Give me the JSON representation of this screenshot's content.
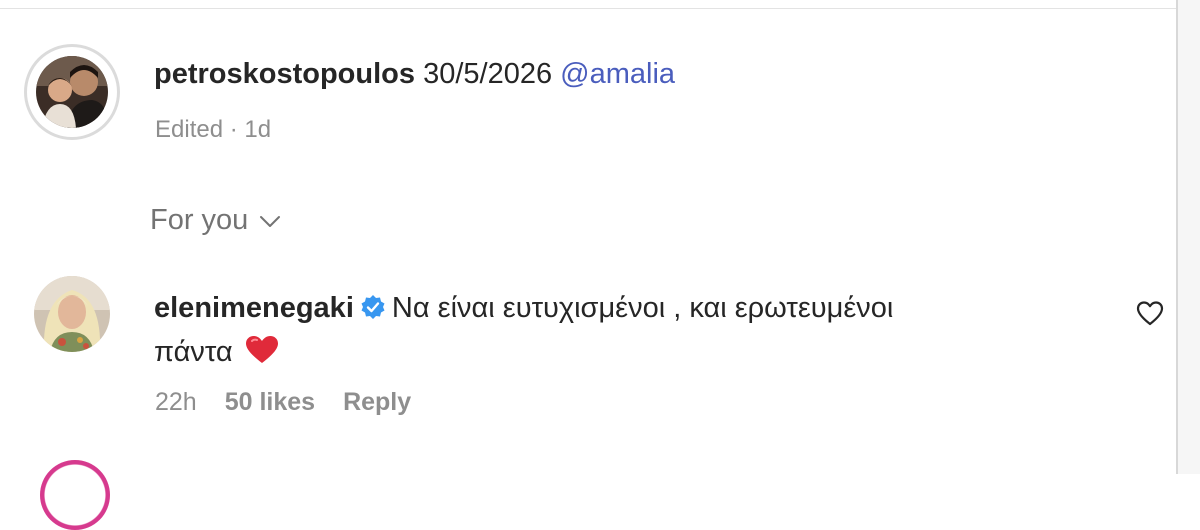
{
  "caption": {
    "username": "petroskostopoulos",
    "text": "30/5/2026",
    "mention": "@amalia",
    "edited_label": "Edited",
    "separator": "·",
    "time": "1d",
    "avatar_icon": "profile-photo-father-child"
  },
  "filter": {
    "label": "For you",
    "icon": "chevron-down-icon"
  },
  "comment": {
    "username": "elenimenegaki",
    "verified_icon": "verified-badge-icon",
    "text_line1": "Να είναι ευτυχισμένοι , και ερωτευμένοι",
    "text_line2": "πάντα",
    "emoji": "red-heart-emoji",
    "time": "22h",
    "likes": "50 likes",
    "reply_label": "Reply",
    "like_icon": "heart-outline-icon"
  },
  "colors": {
    "mention": "#4a5dbd",
    "verified": "#3897f0",
    "heart": "#e02a3a",
    "muted": "#8e8e8e",
    "story_ring": "#d63a8e"
  }
}
